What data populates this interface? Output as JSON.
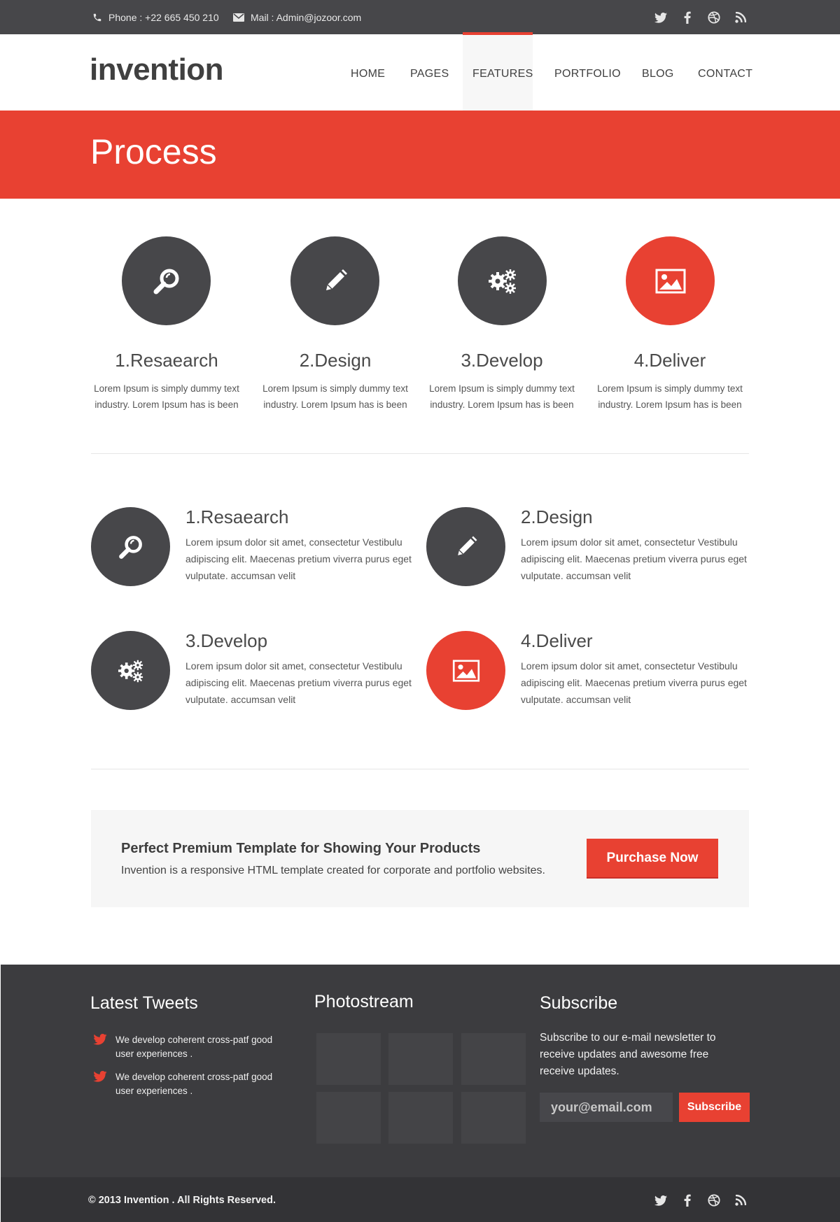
{
  "topbar": {
    "phone": "Phone : +22 665 450 210",
    "mail": "Mail : Admin@jozoor.com",
    "social": [
      "twitter-icon",
      "facebook-icon",
      "dribbble-icon",
      "rss-icon"
    ]
  },
  "header": {
    "logo": "invention",
    "nav": [
      "HOME",
      "PAGES",
      "FEATURES",
      "PORTFOLIO",
      "BLOG",
      "CONTACT"
    ],
    "active": "FEATURES"
  },
  "banner": {
    "title": "Process"
  },
  "process_row1": [
    {
      "title": "1.Resaearch",
      "text": "Lorem Ipsum is simply dummy text industry. Lorem Ipsum has is been",
      "icon": "search-icon"
    },
    {
      "title": "2.Design",
      "text": "Lorem Ipsum is simply dummy text industry. Lorem Ipsum has is been",
      "icon": "pencil-icon"
    },
    {
      "title": "3.Develop",
      "text": "Lorem Ipsum is simply dummy text industry. Lorem Ipsum has is been",
      "icon": "gears-icon"
    },
    {
      "title": "4.Deliver",
      "text": "Lorem Ipsum is simply dummy text industry. Lorem Ipsum has is been",
      "icon": "image-icon"
    }
  ],
  "process_row2": [
    {
      "title": "1.Resaearch",
      "text": "Lorem ipsum dolor sit amet, consectetur Vestibulu adipiscing elit. Maecenas pretium viverra purus eget vulputate. accumsan velit",
      "icon": "search-icon"
    },
    {
      "title": "2.Design",
      "text": "Lorem ipsum dolor sit amet, consectetur Vestibulu adipiscing elit. Maecenas pretium viverra purus eget vulputate. accumsan velit",
      "icon": "pencil-icon"
    },
    {
      "title": "3.Develop",
      "text": "Lorem ipsum dolor sit amet, consectetur Vestibulu adipiscing elit. Maecenas pretium viverra purus eget vulputate. accumsan velit",
      "icon": "gears-icon"
    },
    {
      "title": "4.Deliver",
      "text": "Lorem ipsum dolor sit amet, consectetur Vestibulu adipiscing elit. Maecenas pretium viverra purus eget vulputate. accumsan velit",
      "icon": "image-icon"
    }
  ],
  "cta": {
    "title": "Perfect Premium Template for Showing Your Products",
    "subtitle": "Invention is a responsive HTML template created for corporate and portfolio websites.",
    "button": "Purchase Now"
  },
  "footer": {
    "tweets_heading": "Latest Tweets",
    "tweets": [
      "We develop coherent cross-patf good user experiences .",
      "We develop coherent cross-patf good user experiences ."
    ],
    "photostream_heading": "Photostream",
    "subscribe_heading": "Subscribe",
    "subscribe_text": "Subscribe to our e-mail newsletter to receive updates and awesome free receive updates.",
    "email_placeholder": "your@email.com",
    "subscribe_button": "Subscribe",
    "copyright": "© 2013 Invention . All Rights Reserved."
  },
  "colors": {
    "accent": "#e84132",
    "dark": "#47474a",
    "footer": "#3c3c3f"
  }
}
